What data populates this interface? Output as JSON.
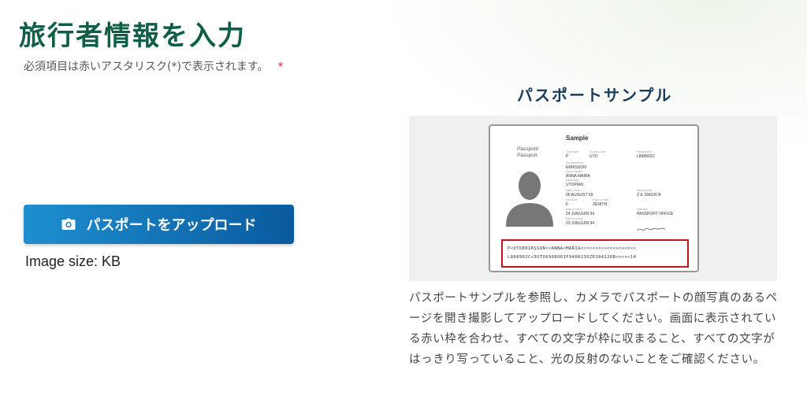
{
  "header": {
    "title": "旅行者情報を入力",
    "required_note": "必須項目は赤いアスタリスク(*)で表示されます。",
    "asterisk": "*"
  },
  "upload": {
    "button_label": "パスポートをアップロード",
    "icon": "camera-icon",
    "image_size": "Image size: KB"
  },
  "sample": {
    "heading": "パスポートサンプル",
    "passport": {
      "sample_label": "Sample",
      "type_label": "Passport/\nPassport",
      "fields": {
        "type": "P",
        "country": "UTO",
        "passport_no": "L898902C",
        "surname": "ERIKSSON",
        "given_names": "ANNA MARIA",
        "nationality": "UTOPIAN",
        "dob": "06 AUGUST 69",
        "personal_no": "Z E 184226 B",
        "sex": "F",
        "place_of_birth": "ZENITH",
        "date_of_issue": "24 JUN/JUIN 94",
        "authority": "PASSPORT OFFICE",
        "date_of_expiry": "23 JUN/JUIN 94"
      },
      "mrz_line1": "P<UTOERIKSSON<<ANNA<MARIA<<<<<<<<<<<<<<<<<<<",
      "mrz_line2": "L898902C<3UTO6908061F9406236ZE184226B<<<<<14"
    },
    "description": "パスポートサンプルを参照し、カメラでパスポートの顔写真のあるページを開き撮影してアップロードしてください。画面に表示されている赤い枠を合わせ、すべての文字が枠に収まること、すべての文字がはっきり写っていること、光の反射のないことをご確認ください。"
  },
  "colors": {
    "title": "#0f5e46",
    "button_start": "#1e8fd0",
    "button_end": "#0a5b9e",
    "asterisk": "#d8262c",
    "mrz_frame": "#c1121f"
  }
}
